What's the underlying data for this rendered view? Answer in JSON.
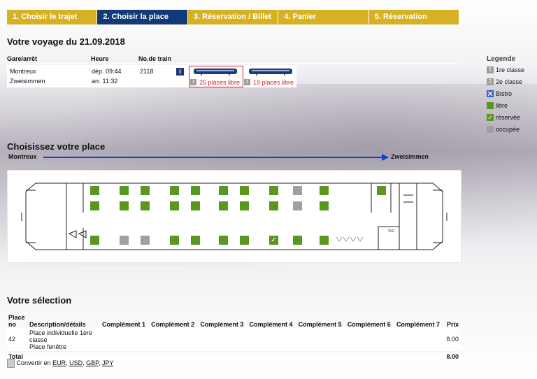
{
  "steps": [
    {
      "label": "1. Choisir le trajet"
    },
    {
      "label": "2. Choisir la place"
    },
    {
      "label": "3. Réservation / Billet"
    },
    {
      "label": "4. Panier"
    },
    {
      "label": "5. Réservation"
    }
  ],
  "colors": {
    "step": "#d6b222",
    "step_active": "#123a78",
    "seat_free": "#59981f",
    "seat_occupied": "#a0a0a0",
    "arrow": "#1b3ec8",
    "alert": "#d2232a"
  },
  "trip": {
    "title": "Votre voyage du 21.09.2018",
    "headers": {
      "station": "Gare/arrêt",
      "time": "Heure",
      "train_no": "No.de train"
    },
    "from": "Montreux",
    "to": "Zweisimmen",
    "dep": "dép. 09:44",
    "arr": "arr. 11:32",
    "train_no": "2118",
    "info_icon": "i",
    "coaches": [
      {
        "class": "1",
        "free": "25 places libre",
        "selected": true
      },
      {
        "class": "2",
        "free": "19 places libre",
        "selected": false
      }
    ]
  },
  "legend": {
    "title": "Legende",
    "items": [
      {
        "label": "1re classe",
        "badge": "1"
      },
      {
        "label": "2e classe",
        "badge": "2"
      },
      {
        "label": "Bistro",
        "icon": "bistro-icon"
      },
      {
        "label": "libre",
        "icon": "seat-free-icon"
      },
      {
        "label": "réservée",
        "icon": "seat-reserved-icon",
        "mark": "✓"
      },
      {
        "label": "occupée",
        "icon": "seat-occupied-icon"
      }
    ]
  },
  "seat_section": {
    "title": "Choisissez votre place",
    "from": "Montreux",
    "to": "Zweisimmen",
    "wc_label": "WC",
    "mark_reserved": "✓"
  },
  "selection": {
    "title": "Votre sélection",
    "headers": {
      "place_no": "Place no",
      "description": "Description/détails",
      "c1": "Complément 1",
      "c2": "Complément 2",
      "c3": "Complément 3",
      "c4": "Complément 4",
      "c5": "Complément 5",
      "c6": "Complément 6",
      "c7": "Complément 7",
      "price": "Prix"
    },
    "row": {
      "place": "42",
      "desc1": "Place individuelle 1ère classe",
      "desc2": "Place fenêtre",
      "price": "8.00"
    },
    "total_label": "Total",
    "total": "8.00"
  },
  "convert": {
    "label": "Convertir en",
    "currencies": [
      "EUR",
      "USD",
      "GBP",
      "JPY"
    ]
  }
}
